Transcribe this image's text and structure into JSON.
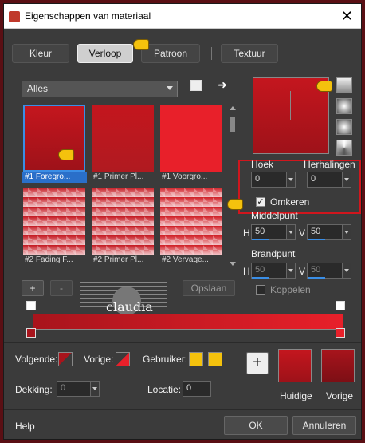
{
  "window": {
    "title": "Eigenschappen van materiaal",
    "close_glyph": "✕"
  },
  "tabs": [
    {
      "label": "Kleur",
      "active": false
    },
    {
      "label": "Verloop",
      "active": true
    },
    {
      "label": "Patroon",
      "active": false
    },
    {
      "label": "Textuur",
      "active": false
    }
  ],
  "category": {
    "value": "Alles"
  },
  "gradients": [
    {
      "label": "#1 Foregro...",
      "selected": true
    },
    {
      "label": "#1 Primer Pl...",
      "selected": false
    },
    {
      "label": "#1 Voorgro...",
      "selected": false
    },
    {
      "label": "#2 Fading F...",
      "selected": false
    },
    {
      "label": "#2 Primer Pl...",
      "selected": false
    },
    {
      "label": "#2 Vervage...",
      "selected": false
    }
  ],
  "list_buttons": {
    "add": "+",
    "remove": "-",
    "save": "Opslaan"
  },
  "watermark": {
    "text": "claudia"
  },
  "params": {
    "angle_label": "Hoek",
    "angle_value": "0",
    "repeats_label": "Herhalingen",
    "repeats_value": "0",
    "invert_label": "Omkeren",
    "invert_checked": true,
    "midpoint_label": "Middelpunt",
    "mid_h_label": "H",
    "mid_h_value": "50",
    "mid_v_label": "V",
    "mid_v_value": "50",
    "focal_label": "Brandpunt",
    "foc_h_label": "H",
    "foc_h_value": "50",
    "foc_v_label": "V",
    "foc_v_value": "50",
    "link_label": "Koppelen",
    "link_checked": false
  },
  "stops": {
    "next_label": "Volgende:",
    "prev_label": "Vorige:",
    "user_label": "Gebruiker:",
    "opacity_label": "Dekking:",
    "opacity_value": "0",
    "location_label": "Locatie:",
    "location_value": "0"
  },
  "current": {
    "add_glyph": "+",
    "current_label": "Huidige",
    "previous_label": "Vorige"
  },
  "footer": {
    "help": "Help",
    "ok": "OK",
    "cancel": "Annuleren"
  },
  "colors": {
    "accent": "#3a8ee6",
    "red_dark": "#a8141c",
    "red_light": "#e8202a",
    "user_yellow": "#f4c20d"
  }
}
